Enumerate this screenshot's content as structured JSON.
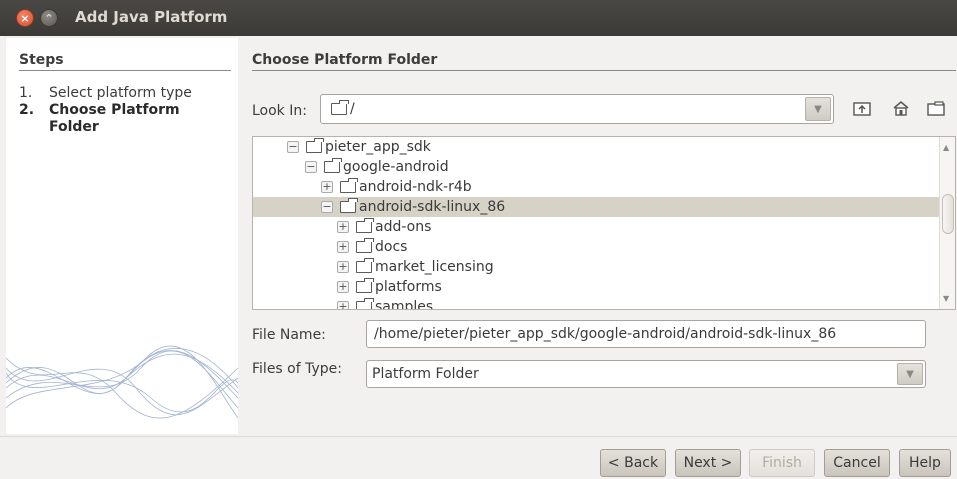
{
  "window": {
    "title": "Add Java Platform"
  },
  "steps": {
    "heading": "Steps",
    "items": [
      {
        "num": "1.",
        "label": "Select platform type"
      },
      {
        "num": "2.",
        "label": "Choose Platform Folder"
      }
    ]
  },
  "main": {
    "heading": "Choose Platform Folder"
  },
  "look_in": {
    "label": "Look In:",
    "value": "/"
  },
  "tree": {
    "items": [
      {
        "toggle": "−",
        "label": "pieter_app_sdk"
      },
      {
        "toggle": "−",
        "label": "google-android"
      },
      {
        "toggle": "+",
        "label": "android-ndk-r4b"
      },
      {
        "toggle": "−",
        "label": "android-sdk-linux_86"
      },
      {
        "toggle": "+",
        "label": "add-ons"
      },
      {
        "toggle": "+",
        "label": "docs"
      },
      {
        "toggle": "+",
        "label": "market_licensing"
      },
      {
        "toggle": "+",
        "label": "platforms"
      },
      {
        "toggle": "+",
        "label": "samples"
      }
    ]
  },
  "file_name": {
    "label": "File Name:",
    "value": "/home/pieter/pieter_app_sdk/google-android/android-sdk-linux_86"
  },
  "files_of_type": {
    "label": "Files of Type:",
    "value": "Platform Folder"
  },
  "buttons": {
    "back": "< Back",
    "next": "Next >",
    "finish": "Finish",
    "cancel": "Cancel",
    "help": "Help"
  }
}
